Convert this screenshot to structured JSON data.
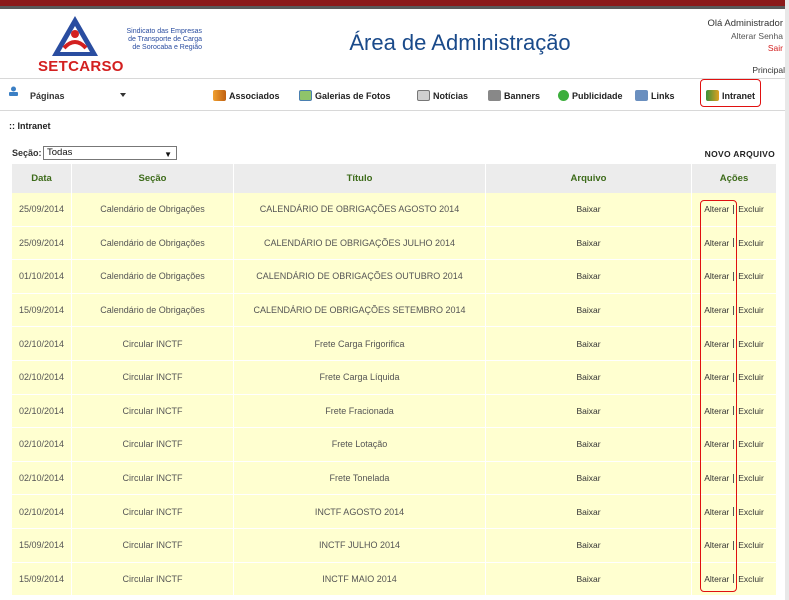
{
  "header": {
    "logo_subtitle_1": "Sindicato das Empresas",
    "logo_subtitle_2": "de Transporte de Carga",
    "logo_subtitle_3": "de Sorocaba e Região",
    "logo_name": "SETCARSO",
    "title": "Área de Administração",
    "greeting": "Olá Administrador",
    "change_password": "Alterar Senha",
    "logout": "Sair",
    "principal": "Principal"
  },
  "nav": {
    "pages_label": "Páginas",
    "items": [
      {
        "label": "Associados",
        "icon": "handshake-icon"
      },
      {
        "label": "Galerias de Fotos",
        "icon": "photo-gallery-icon"
      },
      {
        "label": "Notícias",
        "icon": "news-icon"
      },
      {
        "label": "Banners",
        "icon": "banner-icon"
      },
      {
        "label": "Publicidade",
        "icon": "globe-icon"
      },
      {
        "label": "Links",
        "icon": "links-icon"
      },
      {
        "label": "Intranet",
        "icon": "intranet-icon"
      }
    ]
  },
  "section_title": ":: Intranet",
  "filter": {
    "label": "Seção:",
    "value": "Todas"
  },
  "new_file": "NOVO ARQUIVO",
  "table": {
    "headers": [
      "Data",
      "Seção",
      "Título",
      "Arquivo",
      "Ações"
    ],
    "rows": [
      {
        "data": "25/09/2014",
        "secao": "Calendário de Obrigações",
        "titulo": "CALENDÁRIO DE OBRIGAÇÕES AGOSTO 2014",
        "arquivo": "Baixar"
      },
      {
        "data": "25/09/2014",
        "secao": "Calendário de Obrigações",
        "titulo": "CALENDÁRIO DE OBRIGAÇÕES JULHO 2014",
        "arquivo": "Baixar"
      },
      {
        "data": "01/10/2014",
        "secao": "Calendário de Obrigações",
        "titulo": "CALENDÁRIO DE OBRIGAÇÕES OUTUBRO 2014",
        "arquivo": "Baixar"
      },
      {
        "data": "15/09/2014",
        "secao": "Calendário de Obrigações",
        "titulo": "CALENDÁRIO DE OBRIGAÇÕES SETEMBRO 2014",
        "arquivo": "Baixar"
      },
      {
        "data": "02/10/2014",
        "secao": "Circular INCTF",
        "titulo": "Frete Carga Frigorifica",
        "arquivo": "Baixar"
      },
      {
        "data": "02/10/2014",
        "secao": "Circular INCTF",
        "titulo": "Frete Carga Líquida",
        "arquivo": "Baixar"
      },
      {
        "data": "02/10/2014",
        "secao": "Circular INCTF",
        "titulo": "Frete Fracionada",
        "arquivo": "Baixar"
      },
      {
        "data": "02/10/2014",
        "secao": "Circular INCTF",
        "titulo": "Frete Lotação",
        "arquivo": "Baixar"
      },
      {
        "data": "02/10/2014",
        "secao": "Circular INCTF",
        "titulo": "Frete Tonelada",
        "arquivo": "Baixar"
      },
      {
        "data": "02/10/2014",
        "secao": "Circular INCTF",
        "titulo": "INCTF AGOSTO 2014",
        "arquivo": "Baixar"
      },
      {
        "data": "15/09/2014",
        "secao": "Circular INCTF",
        "titulo": "INCTF JULHO 2014",
        "arquivo": "Baixar"
      },
      {
        "data": "15/09/2014",
        "secao": "Circular INCTF",
        "titulo": "INCTF MAIO 2014",
        "arquivo": "Baixar"
      }
    ],
    "action_edit": "Alterar",
    "action_delete": "Excluir"
  },
  "colors": {
    "accent_red": "#e01010",
    "brand_blue": "#1a4a8a",
    "header_green": "#3d6b1a",
    "row_yellow": "#ffffd0"
  }
}
